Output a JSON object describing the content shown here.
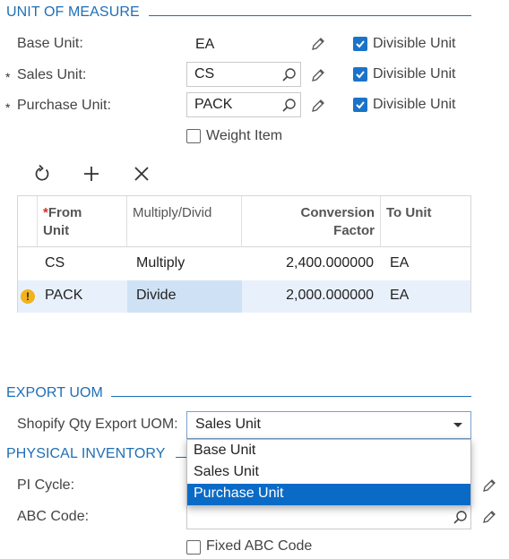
{
  "unit_of_measure": {
    "section_title": "UNIT OF MEASURE",
    "base_unit": {
      "label": "Base Unit:",
      "value": "EA",
      "divisible_label": "Divisible Unit",
      "divisible": true
    },
    "sales_unit": {
      "label": "Sales Unit:",
      "required_mark": "*",
      "value": "CS",
      "divisible_label": "Divisible Unit",
      "divisible": true
    },
    "purchase_unit": {
      "label": "Purchase Unit:",
      "required_mark": "*",
      "value": "PACK",
      "divisible_label": "Divisible Unit",
      "divisible": true
    },
    "weight_item": {
      "label": "Weight Item",
      "checked": false
    }
  },
  "toolbar": {
    "refresh_icon": "refresh-icon",
    "add_icon": "plus-icon",
    "delete_icon": "x-icon"
  },
  "conversion_grid": {
    "columns": [
      {
        "required_mark": "*",
        "line1": "From",
        "line2": "Unit"
      },
      {
        "line1": "Multiply/Divid",
        "line2": ""
      },
      {
        "line1": "Conversion",
        "line2": "Factor"
      },
      {
        "line1": "To Unit",
        "line2": ""
      }
    ],
    "rows": [
      {
        "warning": false,
        "from_unit": "CS",
        "operation": "Multiply",
        "factor": "2,400.000000",
        "to_unit": "EA"
      },
      {
        "warning": true,
        "warning_glyph": "!",
        "from_unit": "PACK",
        "operation": "Divide",
        "factor": "2,000.000000",
        "to_unit": "EA"
      }
    ]
  },
  "export_uom": {
    "section_title": "EXPORT UOM",
    "shopify_label": "Shopify Qty Export UOM:",
    "shopify_value": "Sales Unit",
    "options": [
      "Base Unit",
      "Sales Unit",
      "Purchase Unit"
    ],
    "highlighted_option": "Purchase Unit"
  },
  "physical_inventory": {
    "section_title": "PHYSICAL INVENTORY",
    "pi_cycle_label": "PI Cycle:",
    "pi_cycle_value": "",
    "abc_code_label": "ABC Code:",
    "abc_code_value": "",
    "fixed_abc_label": "Fixed ABC Code",
    "fixed_abc_checked": false
  },
  "colors": {
    "accent": "#1f6fb5",
    "checkbox": "#1a73c9",
    "selected_row": "#e8f1fb",
    "selected_cell": "#cfe2f5",
    "dropdown_highlight": "#0a6bc7",
    "warning": "#f2b21b"
  }
}
